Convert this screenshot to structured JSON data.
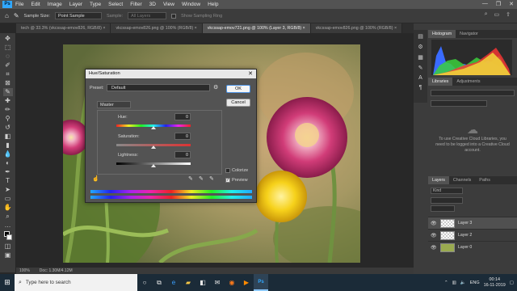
{
  "menubar": {
    "logo": "Ps",
    "items": [
      "File",
      "Edit",
      "Image",
      "Layer",
      "Type",
      "Select",
      "Filter",
      "3D",
      "View",
      "Window",
      "Help"
    ],
    "controls": [
      "—",
      "❐",
      "✕"
    ]
  },
  "options": {
    "sample_size_label": "Sample Size:",
    "sample_size_value": "Point Sample",
    "sample_label": "Sample:",
    "sample_value": "All Layers",
    "show_ring_label": "Show Sampling Ring"
  },
  "tabs": [
    {
      "label": "tech @ 33.3% (vkcssap-emov826, RGB/8) ×"
    },
    {
      "label": "vkcssap-emov826.png @ 100% (RGB/8) ×"
    },
    {
      "label": "vkcssap-emov721.png @ 100% (Layer 3, RGB/8) ×"
    },
    {
      "label": "vkcssap-emov826.png @ 100% (RGB/8) ×"
    }
  ],
  "status": {
    "zoom": "100%",
    "doc": "Doc: 1.30M/4.12M"
  },
  "histogram_panel": {
    "tabs": [
      "Histogram",
      "Navigator"
    ]
  },
  "libraries_panel": {
    "tabs": [
      "Libraries",
      "Adjustments"
    ],
    "message": "To use Creative Cloud Libraries, you need to be logged into a Creative Cloud account."
  },
  "layers_panel": {
    "tabs": [
      "Layers",
      "Channels",
      "Paths"
    ],
    "kind": "Kind",
    "layers": [
      {
        "name": "Layer 3"
      },
      {
        "name": "Layer 2"
      },
      {
        "name": "Layer 0"
      }
    ]
  },
  "dialog": {
    "title": "Hue/Saturation",
    "preset_label": "Preset:",
    "preset_value": "Default",
    "ok": "OK",
    "cancel": "Cancel",
    "channel": "Master",
    "hue_label": "Hue:",
    "hue_value": "0",
    "saturation_label": "Saturation:",
    "saturation_value": "0",
    "lightness_label": "Lightness:",
    "lightness_value": "0",
    "colorize_label": "Colorize",
    "preview_label": "Preview",
    "colorize_checked": false,
    "preview_checked": true
  },
  "taskbar": {
    "search_placeholder": "Type here to search",
    "lang": "ENG",
    "time": "00:14",
    "date": "16-11-2019"
  },
  "colors": {
    "ps_blue": "#31a8ff",
    "panel": "#3c3c3c",
    "dark": "#282828",
    "taskbar": "#1b2b38"
  }
}
